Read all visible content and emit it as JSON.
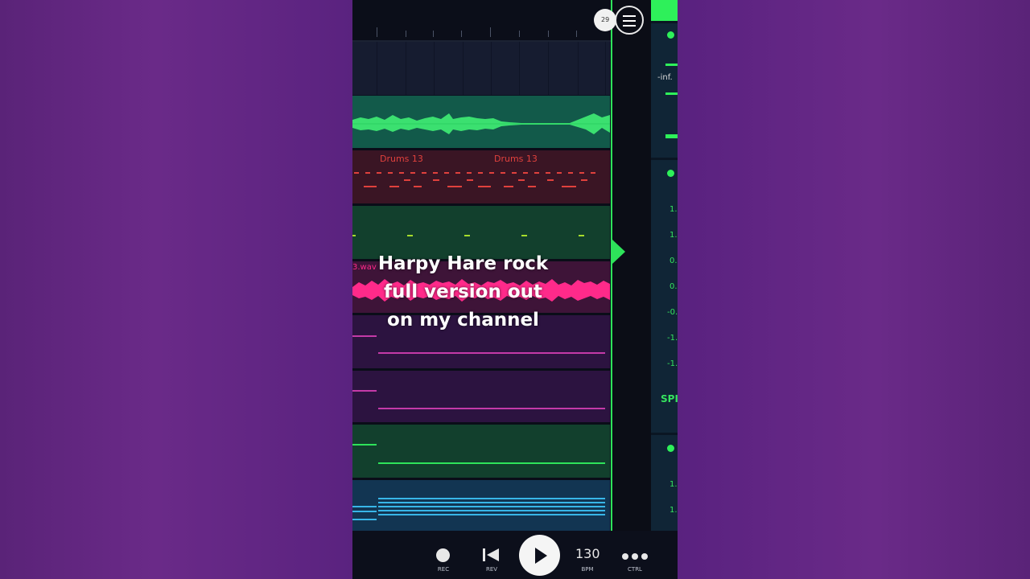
{
  "sidebar_numbers": [
    "1.",
    "1.",
    "0.",
    "0.",
    "-0.",
    "-1.",
    "-1."
  ],
  "mixer": {
    "inf_label": "-inf.",
    "spr_label": "SPI",
    "lower_numbers": [
      "1.",
      "1."
    ]
  },
  "badge": {
    "number": "29"
  },
  "tracks": {
    "drums_clip_1": "Drums 13",
    "drums_clip_2": "Drums 13",
    "audio_clip": "3.wav"
  },
  "transport": {
    "rec_label": "REC",
    "rev_label": "REV",
    "bpm_value": "130",
    "bpm_label": "BPM",
    "ctrl_label": "CTRL"
  },
  "caption": {
    "line1": "Harpy Hare rock",
    "line2": "full version out",
    "line3": "on my channel"
  },
  "colors": {
    "accent_green": "#2ee35a",
    "drums_red": "#e0413d",
    "audio_pink": "#ff2a8a",
    "midi_magenta": "#c43aa8",
    "midi_blue": "#38b6e8"
  },
  "icons": [
    "menu-icon",
    "record-icon",
    "rewind-icon",
    "play-icon",
    "more-icon"
  ]
}
